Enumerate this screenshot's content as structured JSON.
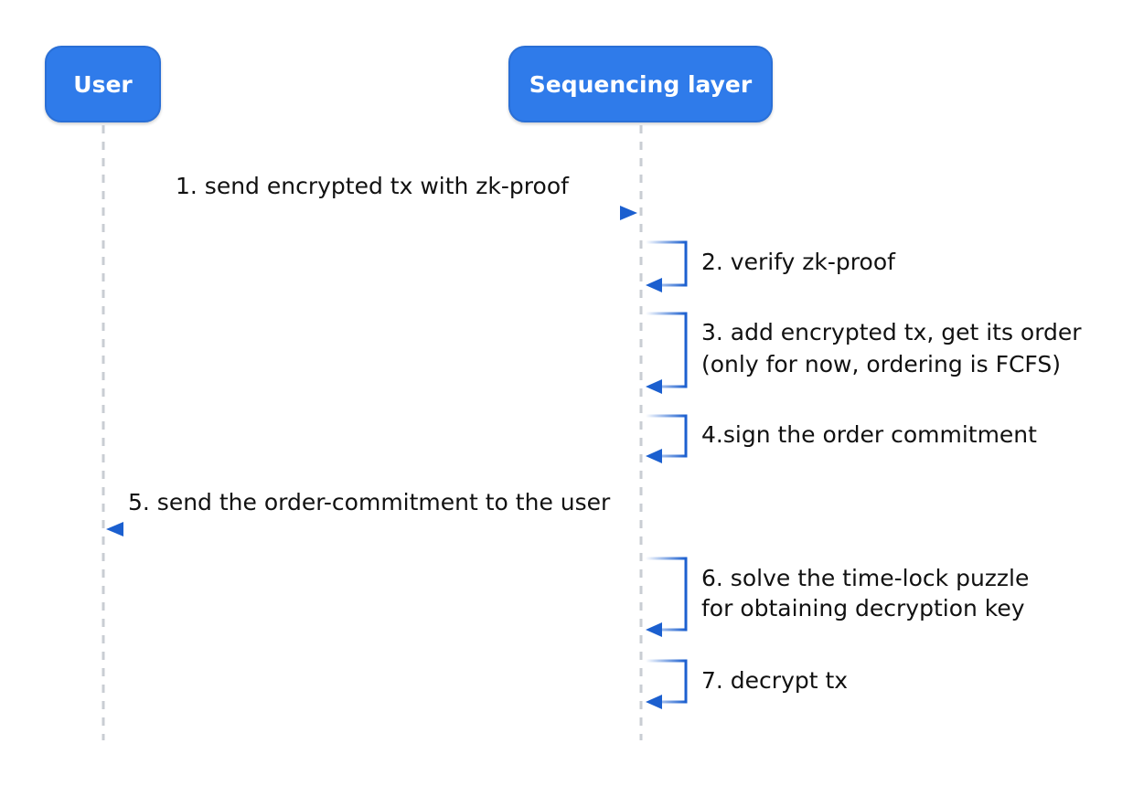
{
  "actors": {
    "user": "User",
    "sequencer": "Sequencing layer"
  },
  "messages": {
    "m1": "1. send encrypted tx with zk-proof",
    "m2": "2. verify zk-proof",
    "m3_line1": "3. add encrypted tx, get its order",
    "m3_line2": "(only for now, ordering is FCFS)",
    "m4": "4.sign the order commitment",
    "m5": "5. send the order-commitment to the user",
    "m6_line1": "6. solve the time-lock puzzle",
    "m6_line2": "for obtaining decryption key",
    "m7": "7. decrypt tx"
  },
  "colors": {
    "actor_fill": "#2f7bea",
    "arrow": "#1b5fcf",
    "lifeline": "#c9cdd3"
  }
}
